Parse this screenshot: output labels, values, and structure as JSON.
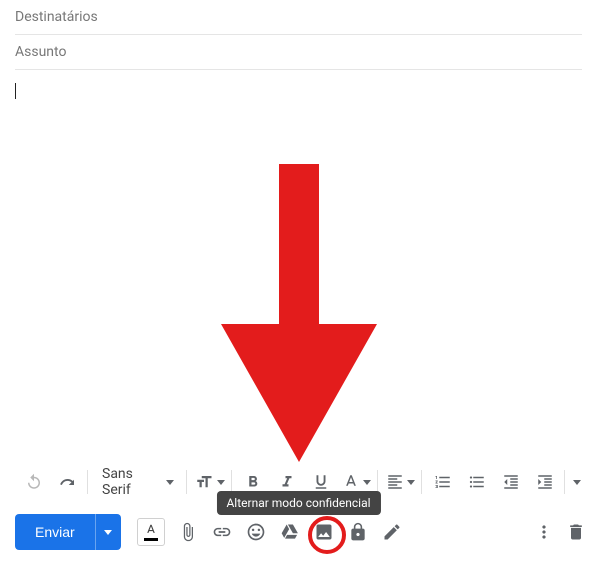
{
  "fields": {
    "recipients_placeholder": "Destinatários",
    "subject_placeholder": "Assunto"
  },
  "toolbar": {
    "font_family": "Sans Serif"
  },
  "tooltip": "Alternar modo confidencial",
  "send": {
    "label": "Enviar"
  }
}
